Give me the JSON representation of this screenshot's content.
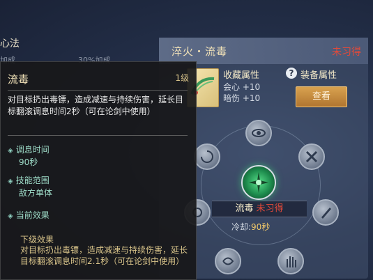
{
  "left_panel": {
    "title": "心法",
    "bonus_left": "加成",
    "bonus_right": "30%加成"
  },
  "panel": {
    "title": "淬火・流毒",
    "status": "未习得",
    "collect_title": "收藏属性",
    "collect_attrs": [
      "会心 +10",
      "暗伤 +10"
    ],
    "help_icon": "?",
    "equip_label": "装备属性",
    "view_button": "查看"
  },
  "wheel": {
    "center_skill": "流毒",
    "center_status": "未习得",
    "cooldown_label": "冷却:",
    "cooldown_value": "90秒"
  },
  "tooltip": {
    "title": "流毒",
    "level": "1级",
    "description": "对目标扔出毒镖，造成减速与持续伤害，延长目标翻滚调息时间2秒（可在论剑中使用）",
    "items": [
      {
        "label": "调息时间",
        "value": "90秒"
      },
      {
        "label": "技能范围",
        "value": "敌方单体"
      },
      {
        "label": "当前效果",
        "value": ""
      }
    ],
    "next_title": "下级效果",
    "next_desc": "对目标扔出毒镖，造成减速与持续伤害，延长目标翻滚调息时间2.1秒（可在论剑中使用）"
  },
  "colors": {
    "accent_red": "#e24a3a",
    "gold": "#d9c48a",
    "teal": "#9edcc8"
  }
}
